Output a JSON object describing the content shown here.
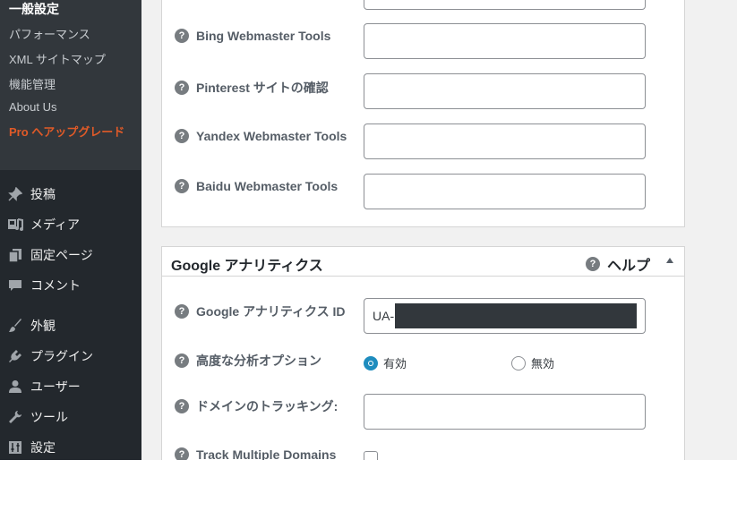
{
  "sidebar": {
    "submenu": {
      "current": "一般設定",
      "items": [
        "パフォーマンス",
        "XML サイトマップ",
        "機能管理",
        "About Us"
      ],
      "upgrade_label": "Pro へアップグレード"
    },
    "menu": [
      {
        "label": "投稿",
        "icon": "pushpin-icon"
      },
      {
        "label": "メディア",
        "icon": "media-icon"
      },
      {
        "label": "固定ページ",
        "icon": "pages-icon"
      },
      {
        "label": "コメント",
        "icon": "comment-icon"
      },
      {
        "label": "外観",
        "icon": "paintbrush-icon"
      },
      {
        "label": "プラグイン",
        "icon": "plugin-icon"
      },
      {
        "label": "ユーザー",
        "icon": "user-icon"
      },
      {
        "label": "ツール",
        "icon": "wrench-icon"
      },
      {
        "label": "設定",
        "icon": "settings-icon"
      }
    ],
    "colors": {
      "background": "#23282d",
      "submenu": "#32373c",
      "upgrade": "#e05a28"
    }
  },
  "webmaster_tools": {
    "fields": [
      {
        "label": "Bing Webmaster Tools",
        "value": ""
      },
      {
        "label": "Pinterest サイトの確認",
        "value": ""
      },
      {
        "label": "Yandex Webmaster Tools",
        "value": ""
      },
      {
        "label": "Baidu Webmaster Tools",
        "value": ""
      }
    ]
  },
  "google_analytics": {
    "title": "Google アナリティクス",
    "help_label": "ヘルプ",
    "help_symbol": "?",
    "id_field": {
      "label": "Google アナリティクス ID",
      "value_prefix": "UA-"
    },
    "advanced": {
      "label": "高度な分析オプション",
      "options": [
        {
          "label": "有効",
          "checked": true
        },
        {
          "label": "無効",
          "checked": false
        }
      ]
    },
    "domain_tracking": {
      "label": "ドメインのトラッキング:",
      "value": ""
    },
    "multiple_domains": {
      "label": "Track Multiple Domains",
      "checked": false
    }
  },
  "accent_color": "#1e8cbe"
}
